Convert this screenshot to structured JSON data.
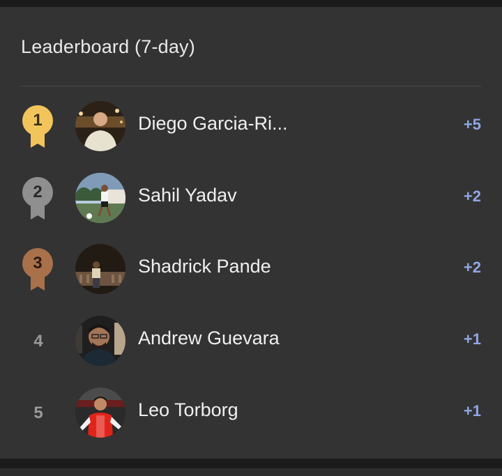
{
  "leaderboard": {
    "title": "Leaderboard (7-day)",
    "entries": [
      {
        "rank": "1",
        "name": "Diego Garcia-Ri...",
        "delta": "+5",
        "medal": "gold",
        "medal_color": "#f2c55c"
      },
      {
        "rank": "2",
        "name": "Sahil Yadav",
        "delta": "+2",
        "medal": "silver",
        "medal_color": "#8f8f8f"
      },
      {
        "rank": "3",
        "name": "Shadrick Pande",
        "delta": "+2",
        "medal": "bronze",
        "medal_color": "#a8714a"
      },
      {
        "rank": "4",
        "name": "Andrew Guevara",
        "delta": "+1",
        "medal": "none"
      },
      {
        "rank": "5",
        "name": "Leo Torborg",
        "delta": "+1",
        "medal": "none"
      }
    ]
  },
  "colors": {
    "background": "#333333",
    "text": "#f0f0f0",
    "delta": "#8fa7e4",
    "rank_plain": "#9a9a9a"
  }
}
